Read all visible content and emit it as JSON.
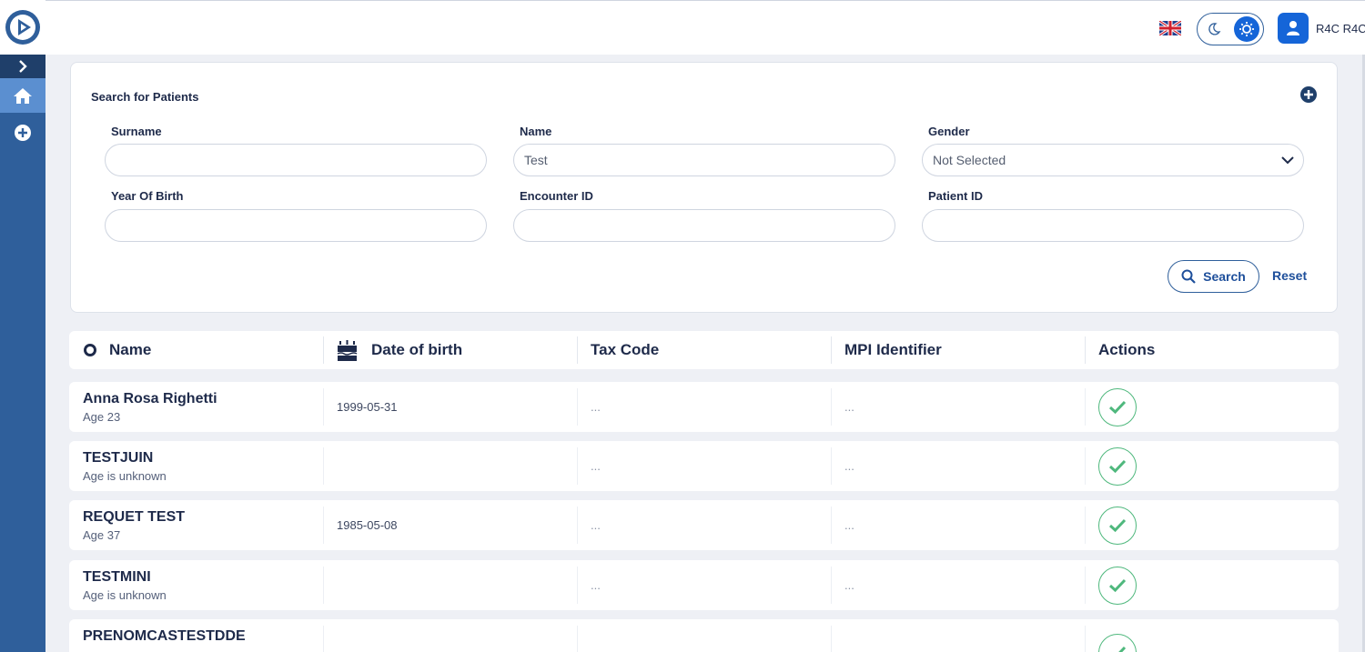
{
  "header": {
    "user_name": "R4C R4C",
    "language_flag": "uk-flag-icon"
  },
  "search": {
    "title": "Search for Patients",
    "fields": {
      "surname": {
        "label": "Surname",
        "value": ""
      },
      "name": {
        "label": "Name",
        "value": "Test"
      },
      "gender": {
        "label": "Gender",
        "value": "Not Selected"
      },
      "year_of_birth": {
        "label": "Year Of Birth",
        "value": ""
      },
      "encounter_id": {
        "label": "Encounter ID",
        "value": ""
      },
      "patient_id": {
        "label": "Patient ID",
        "value": ""
      }
    },
    "search_label": "Search",
    "reset_label": "Reset"
  },
  "table": {
    "columns": {
      "name": "Name",
      "dob": "Date of birth",
      "tax": "Tax Code",
      "mpi": "MPI Identifier",
      "actions": "Actions"
    },
    "rows": [
      {
        "name": "Anna Rosa Righetti",
        "age": "Age 23",
        "dob": "1999-05-31",
        "tax": "...",
        "mpi": "..."
      },
      {
        "name": "TESTJUIN",
        "age": "Age is unknown",
        "dob": "",
        "tax": "...",
        "mpi": "..."
      },
      {
        "name": "REQUET TEST",
        "age": "Age 37",
        "dob": "1985-05-08",
        "tax": "...",
        "mpi": "..."
      },
      {
        "name": "TESTMINI",
        "age": "Age is unknown",
        "dob": "",
        "tax": "...",
        "mpi": "..."
      },
      {
        "name": "PRENOMCASTESTDDE",
        "age": "",
        "dob": "",
        "tax": "",
        "mpi": ""
      }
    ]
  },
  "colors": {
    "sidebar": "#2f5f9b",
    "accent": "#1565d8",
    "success": "#4fb87d"
  }
}
